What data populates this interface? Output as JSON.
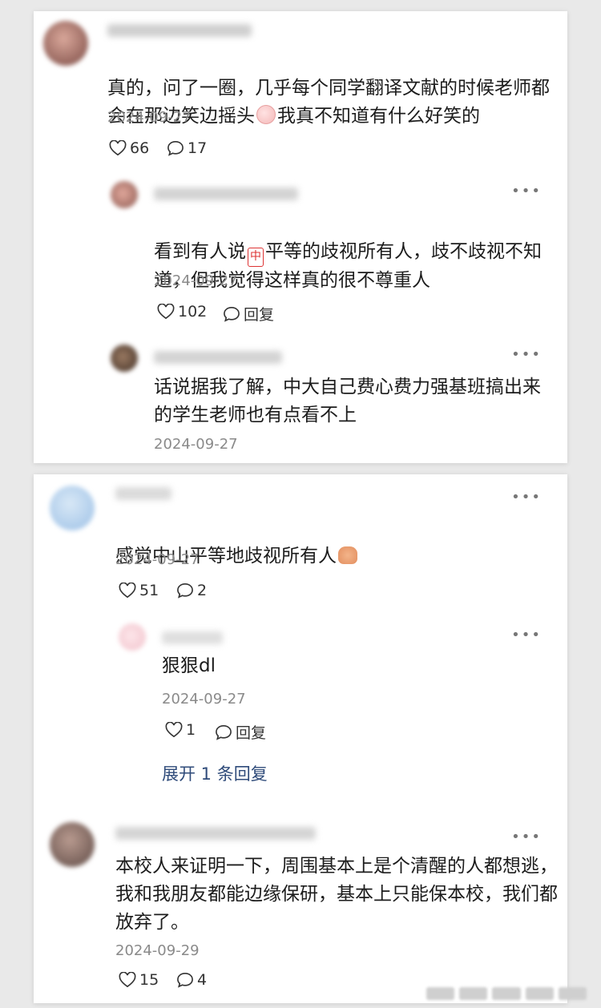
{
  "colors": {
    "accent_link": "#2f4b7a",
    "muted": "#8a8a8a"
  },
  "icons": {
    "like": "heart-outline-icon",
    "comment": "comment-bubble-icon",
    "more": "more-dots-icon"
  },
  "threads": [
    {
      "comment": {
        "content": "真的，问了一圈，几乎每个同学翻译文献的时候老师都\n会在那边笑边摇头",
        "content_tail": "我真不知道有什么好笑的",
        "date": "2024-09-27",
        "likes": "66",
        "comments": "17"
      },
      "replies": [
        {
          "content_head": "看到有人说",
          "emoji_char": "中",
          "content": "平等的歧视所有人，歧不歧视不知\n道，但我觉得这样真的很不尊重人",
          "date": "2024-09-27",
          "likes": "102",
          "reply_label": "回复"
        },
        {
          "content": "话说据我了解，中大自己费心费力强基班搞出来\n的学生老师也有点看不上",
          "date": "2024-09-27"
        }
      ]
    },
    {
      "comment": {
        "content": "感觉中山平等地歧视所有人",
        "date": "2024-09-27",
        "likes": "51",
        "comments": "2"
      },
      "replies": [
        {
          "content": "狠狠dl",
          "date": "2024-09-27",
          "likes": "1",
          "reply_label": "回复"
        }
      ],
      "expand_label": "展开 1 条回复"
    },
    {
      "comment": {
        "content": "本校人来证明一下，周围基本上是个清醒的人都想逃，\n我和我朋友都能边缘保研，基本上只能保本校，我们都\n放弃了。",
        "date": "2024-09-29",
        "likes": "15",
        "comments": "4"
      }
    }
  ]
}
